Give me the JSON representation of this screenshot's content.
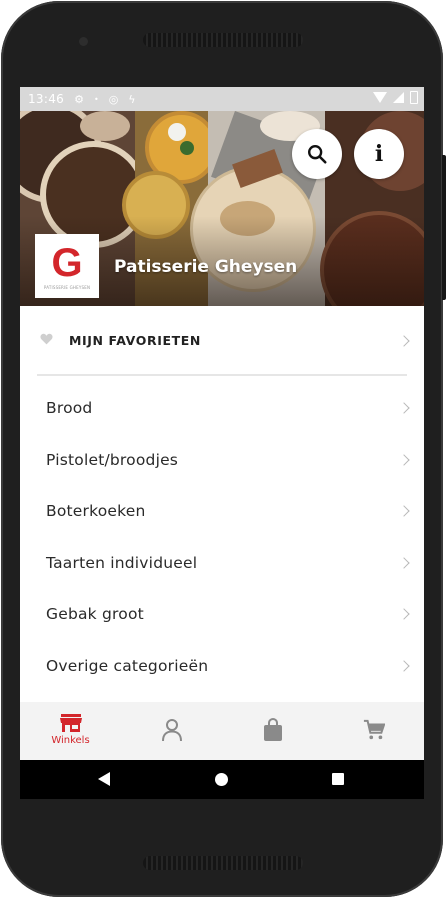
{
  "status_bar": {
    "time": "13:46",
    "icons": [
      "gear-icon",
      "dot-icon",
      "circle-icon",
      "bolt-icon",
      "wifi-icon",
      "signal-icon",
      "battery-icon"
    ]
  },
  "header": {
    "shop_name": "Patisserie Gheysen",
    "logo_letter": "G",
    "logo_subtext": "PATISSERIE GHEYSEN",
    "search_icon": "search-icon",
    "info_icon": "info-icon",
    "info_glyph": "i"
  },
  "favorites": {
    "label": "MIJN FAVORIETEN",
    "icon": "heart-icon"
  },
  "categories": [
    {
      "label": "Brood"
    },
    {
      "label": "Pistolet/broodjes"
    },
    {
      "label": "Boterkoeken"
    },
    {
      "label": "Taarten individueel"
    },
    {
      "label": "Gebak groot"
    },
    {
      "label": "Overige categorieën"
    }
  ],
  "bottom_nav": {
    "items": [
      {
        "label": "Winkels",
        "icon": "store-icon",
        "active": true
      },
      {
        "label": "",
        "icon": "profile-icon",
        "active": false
      },
      {
        "label": "",
        "icon": "bag-icon",
        "active": false
      },
      {
        "label": "",
        "icon": "cart-icon",
        "active": false
      }
    ]
  },
  "colors": {
    "accent": "#d3262b",
    "inactive_icon": "#8a8a8a",
    "nav_background": "#f3f3f3"
  }
}
